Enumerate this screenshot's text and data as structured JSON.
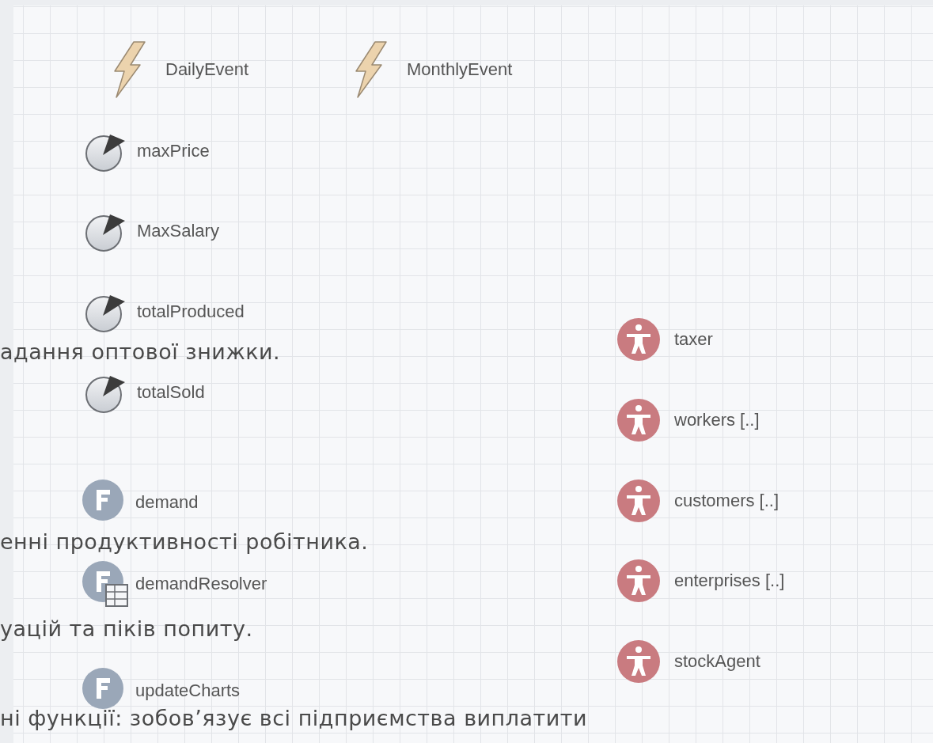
{
  "events": [
    {
      "name": "DailyEvent"
    },
    {
      "name": "MonthlyEvent"
    }
  ],
  "variables": [
    {
      "name": "maxPrice"
    },
    {
      "name": "MaxSalary"
    },
    {
      "name": "totalProduced"
    },
    {
      "name": "totalSold"
    }
  ],
  "functions": [
    {
      "name": "demand",
      "kind": "function"
    },
    {
      "name": "demandResolver",
      "kind": "table_function"
    },
    {
      "name": "updateCharts",
      "kind": "function"
    }
  ],
  "agents": [
    {
      "name": "taxer"
    },
    {
      "name": "workers [..]"
    },
    {
      "name": "customers [..]"
    },
    {
      "name": "enterprises [..]"
    },
    {
      "name": "stockAgent"
    }
  ],
  "overlay_text": [
    "адання оптової знижки.",
    "енні продуктивності робітника.",
    "уацій та піків попиту.",
    "ні функції: зобов’язує всі підприємства виплатити"
  ]
}
